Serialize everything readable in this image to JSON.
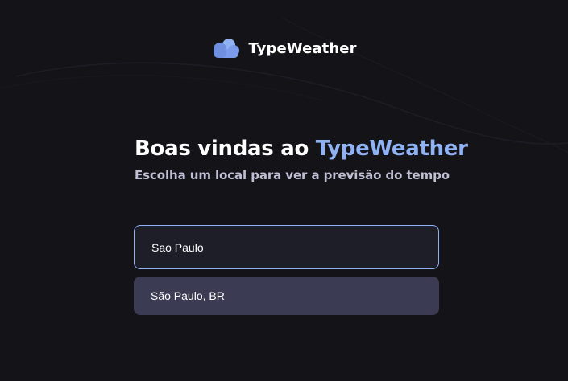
{
  "app": {
    "name": "TypeWeather",
    "logo_icon": "cloud-icon"
  },
  "welcome": {
    "heading_prefix": "Boas vindas ao ",
    "heading_brand": "TypeWeather",
    "subtitle": "Escolha um local para ver a previsão do tempo"
  },
  "search": {
    "value": "Sao Paulo",
    "placeholder": ""
  },
  "suggestions": [
    {
      "label": "São Paulo, BR"
    }
  ],
  "colors": {
    "background": "#141318",
    "accent": "#8FB2F5",
    "input_background": "#1E1E29",
    "suggestion_background": "#3B3B54",
    "subtitle_text": "#BFBFD4"
  }
}
